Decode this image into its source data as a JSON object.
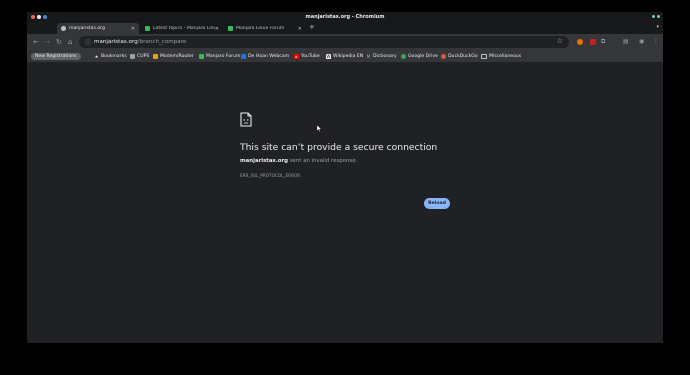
{
  "window": {
    "title": "manjaristas.org - Chromium"
  },
  "tabs": [
    {
      "label": "manjaristas.org",
      "favicon_color": "#bdc1c6",
      "active": true
    },
    {
      "label": "Latest topics - Manjaro Linux",
      "favicon_color": "#34be5b",
      "active": false
    },
    {
      "label": "Manjaro Linux Forum",
      "favicon_color": "#34be5b",
      "active": false
    }
  ],
  "toolbar": {
    "url_host": "manjaristas.org",
    "url_path": "/branch_compare"
  },
  "bookmarks": [
    {
      "label": "New Registrations",
      "icon": "pill",
      "color": "#5f6368"
    },
    {
      "label": "Bookmarks",
      "icon": "star-icon",
      "color": "#e8eaed"
    },
    {
      "label": "CUPS",
      "icon": "printer-icon",
      "color": "#9aa0a6"
    },
    {
      "label": "Modem/Router",
      "icon": "router-icon",
      "color": "#e5a50a"
    },
    {
      "label": "Manjaro Forum",
      "icon": "manjaro-icon",
      "color": "#34be5b"
    },
    {
      "label": "De Haan Webcam",
      "icon": "webcam-icon",
      "color": "#1a73e8"
    },
    {
      "label": "YouTube",
      "icon": "youtube-icon",
      "color": "#ff0000"
    },
    {
      "label": "Wikipedia EN",
      "icon": "wikipedia-icon",
      "color": "#ffffff"
    },
    {
      "label": "Dictionary",
      "icon": "dictionary-icon",
      "color": "#1a73e8"
    },
    {
      "label": "Google Drive",
      "icon": "drive-icon",
      "color": "#34a853"
    },
    {
      "label": "DuckDuckGo",
      "icon": "duckduckgo-icon",
      "color": "#de5833"
    },
    {
      "label": "Miscellaneous",
      "icon": "folder-icon",
      "color": "#bdc1c6"
    }
  ],
  "error": {
    "title": "This site can’t provide a secure connection",
    "host": "manjaristas.org",
    "message": " sent an invalid response.",
    "code": "ERR_SSL_PROTOCOL_ERROR",
    "reload_label": "Reload"
  },
  "colors": {
    "accent": "#8ab4f8",
    "background": "#202124",
    "toolbar": "#35363a"
  }
}
